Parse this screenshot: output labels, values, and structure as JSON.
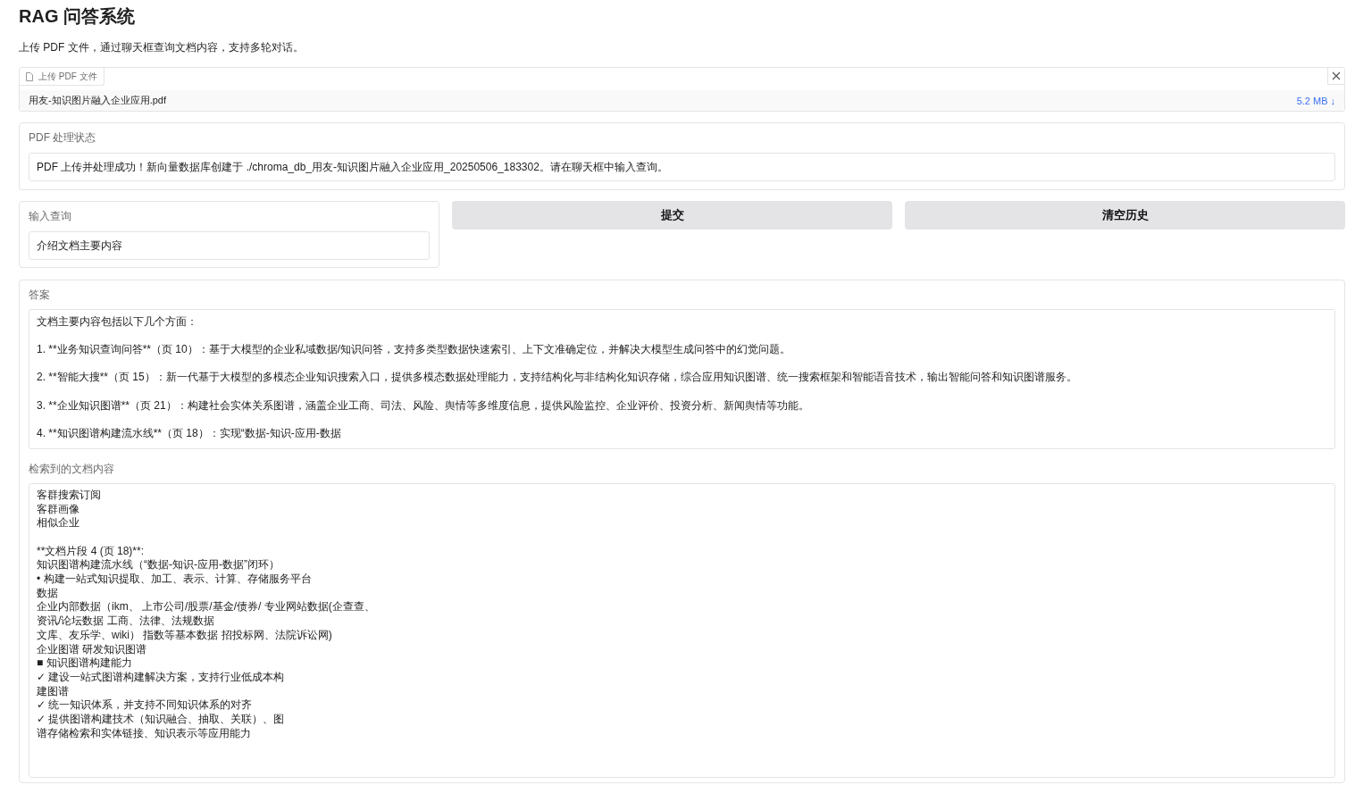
{
  "title": "RAG 问答系统",
  "description": "上传 PDF 文件，通过聊天框查询文档内容，支持多轮对话。",
  "upload": {
    "label": "上传 PDF 文件",
    "file_name": "用友-知识图片融入企业应用.pdf",
    "file_size": "5.2 MB",
    "download": "↓"
  },
  "status": {
    "label": "PDF 处理状态",
    "value": "PDF 上传并处理成功！新向量数据库创建于 ./chroma_db_用友-知识图片融入企业应用_20250506_183302。请在聊天框中输入查询。"
  },
  "query": {
    "label": "输入查询",
    "value": "介绍文档主要内容"
  },
  "buttons": [
    "提交",
    "清空历史"
  ],
  "answer": {
    "label": "答案",
    "paragraphs": [
      [
        "文档主要内容包括以下几个方面："
      ],
      [
        "1. **业务知识查询问答**（页 10）：基于大模型的企业私域数据/知识问答，支持多类型数据快速索引、上下文准确定位，并解决大模型生成问答中的幻觉问题。"
      ],
      [
        "2. **智能大搜**（页 15）：新一代基于大模型的多模态企业知识搜索入口，提供多模态数据处理能力，支持结构化与非结构化知识存储，综合应用知识图谱、统一搜索框架和智能语音技术，输出智能问答和知识图谱服务。"
      ],
      [
        "3. **企业知识图谱**（页 21）：构建社会实体关系图谱，涵盖企业工商、司法、风险、舆情等多维度信息，提供风险监控、企业评价、投资分析、新闻舆情等功能。"
      ],
      [
        "4. **知识图谱构建流水线**（页 18）：实现“数据-知识-应用-数据"
      ]
    ]
  },
  "retrieved": {
    "label": "检索到的文档内容",
    "paragraphs": [
      [
        "客群搜索订阅",
        "客群画像",
        "相似企业"
      ],
      [
        "**文档片段 4 (页 18)**:",
        "知识图谱构建流水线（“数据-知识-应用-数据”闭环）",
        "• 构建一站式知识提取、加工、表示、计算、存储服务平台",
        "数据",
        "企业内部数据（ikm、 上市公司/股票/基金/债券/ 专业网站数据(企查查、",
        "资讯/论坛数据 工商、法律、法规数据",
        "文库、友乐学、wiki） 指数等基本数据 招投标网、法院诉讼网)",
        "企业图谱 研发知识图谱",
        "■ 知识图谱构建能力",
        "✓ 建设一站式图谱构建解决方案，支持行业低成本构",
        "建图谱",
        "✓ 统一知识体系，并支持不同知识体系的对齐",
        "✓ 提供图谱构建技术（知识融合、抽取、关联）、图",
        "谱存储检索和实体链接、知识表示等应用能力"
      ]
    ]
  }
}
